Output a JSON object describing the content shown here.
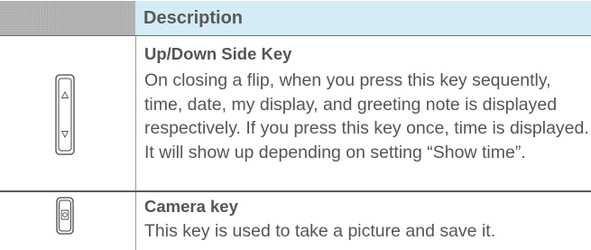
{
  "header": {
    "title": "Description"
  },
  "rows": [
    {
      "icon": "up-down-side-key-icon",
      "title": "Up/Down Side Key",
      "text": "On closing a flip, when you press this key sequently, time, date, my display, and greeting note is displayed respectively. If you press this key once, time is displayed. It will show up depending on setting “Show time”."
    },
    {
      "icon": "camera-key-icon",
      "title": "Camera key",
      "text": "This key is used to take a picture and save it."
    }
  ],
  "colors": {
    "header_left_bg": "#b5b5b5",
    "header_right_bg": "#d4ecf5",
    "text": "#555555",
    "rule": "#5a5a5a"
  }
}
